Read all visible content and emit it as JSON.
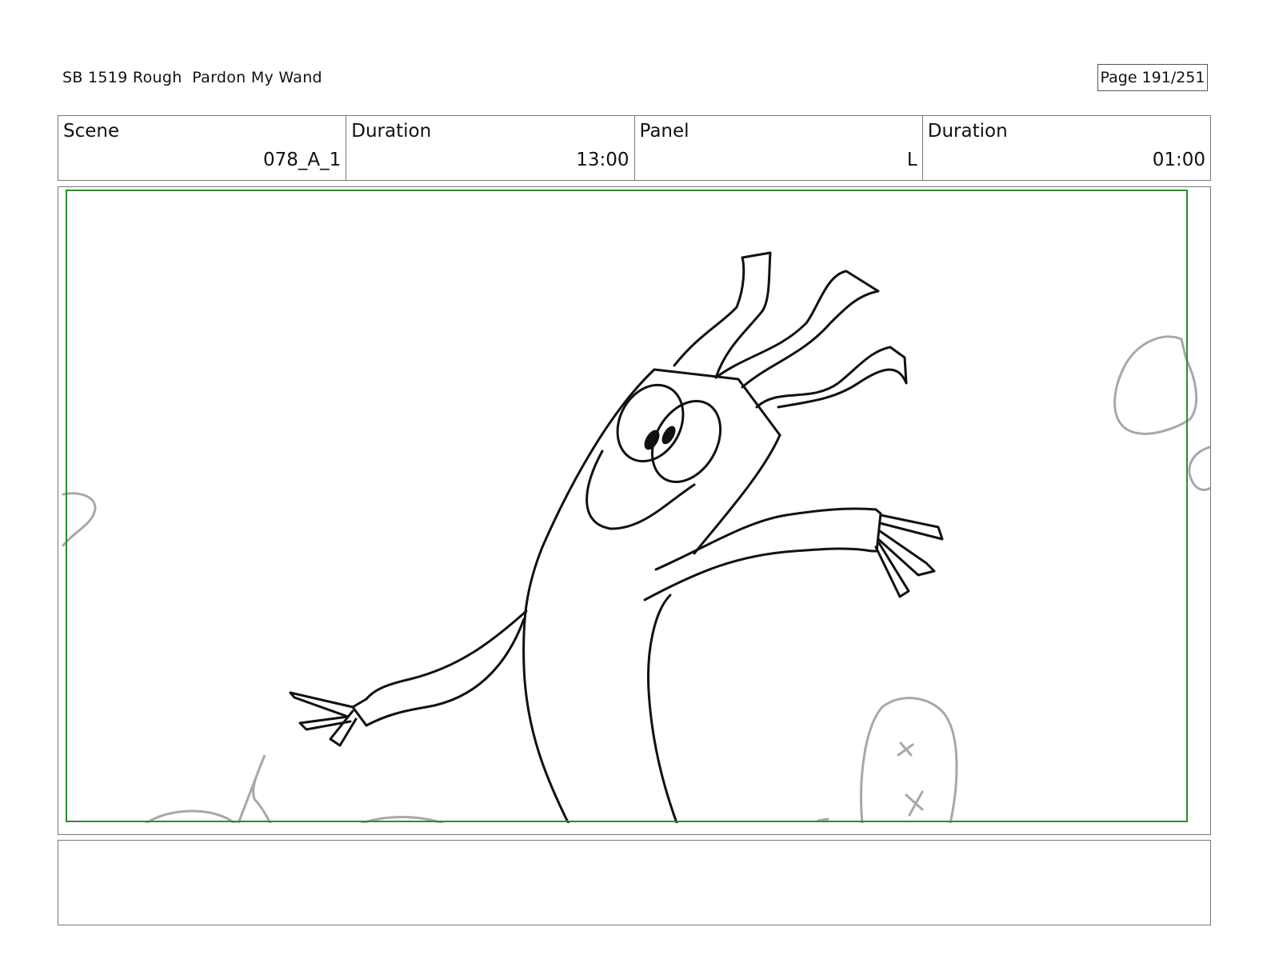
{
  "header": {
    "title": "SB 1519 Rough  Pardon My Wand",
    "page_number": "Page 191/251"
  },
  "info": {
    "scene_label": "Scene",
    "scene_value": "078_A_1",
    "scene_duration_label": "Duration",
    "scene_duration_value": "13:00",
    "panel_label": "Panel",
    "panel_value": "L",
    "panel_duration_label": "Duration",
    "panel_duration_value": "01:00"
  },
  "colors": {
    "safe_frame": "#2e8b2e",
    "line_art": "#111111",
    "background_art": "#a8a8a8"
  },
  "notes": {
    "text": ""
  }
}
